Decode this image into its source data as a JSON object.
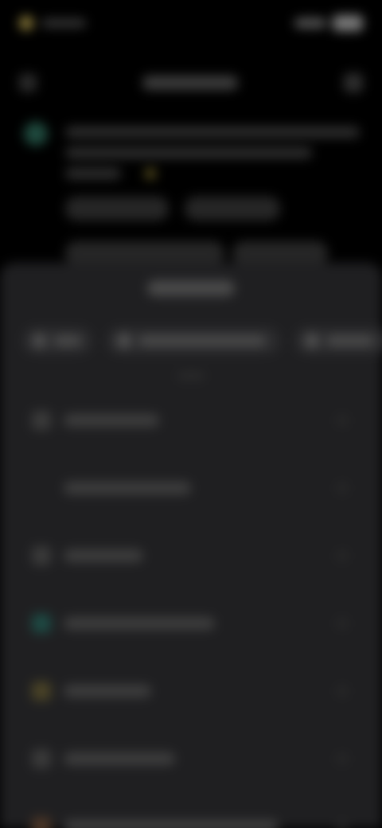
{
  "screen": {
    "note_visible_text": ""
  },
  "colors": {
    "background": "#000000",
    "sheet": "#1f1f21",
    "accent_green": "#1f4a3e",
    "accent_gold": "#5d5420"
  },
  "status_bar": {
    "time": "",
    "battery": ""
  },
  "header": {
    "title": ""
  },
  "sheet": {
    "title": "",
    "tabs": [
      {
        "label": "",
        "icon": "copy-icon"
      },
      {
        "label": "",
        "icon": "folder-icon"
      },
      {
        "label": "",
        "icon": "share-icon"
      }
    ],
    "items": [
      {
        "label": "",
        "icon": "reply-icon"
      },
      {
        "label": "",
        "icon": "forward-icon"
      },
      {
        "label": "",
        "icon": "copy-icon"
      },
      {
        "label": "",
        "icon": "pin-icon"
      },
      {
        "label": "",
        "icon": "star-icon"
      },
      {
        "label": "",
        "icon": "select-icon"
      },
      {
        "label": "",
        "icon": "delete-icon"
      }
    ]
  }
}
